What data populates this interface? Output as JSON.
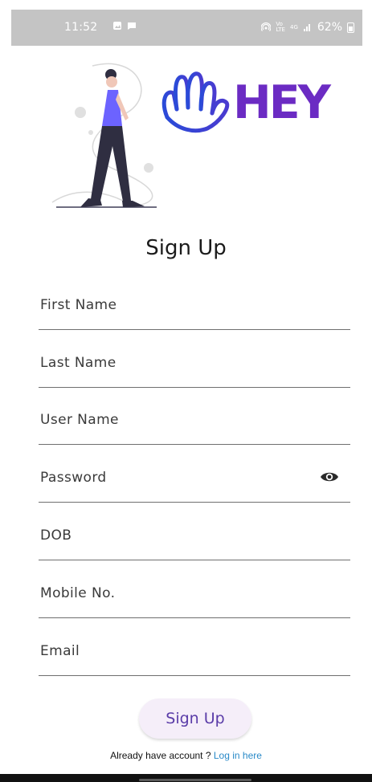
{
  "status_bar": {
    "time": "11:52",
    "battery": "62%",
    "network": "4G"
  },
  "logo": {
    "text": "HEY",
    "colors": [
      "#2a4bd8",
      "#6b2bc3"
    ],
    "icon": "wave-hand-icon"
  },
  "title": "Sign Up",
  "form": {
    "fields": [
      {
        "label": "First Name"
      },
      {
        "label": "Last Name"
      },
      {
        "label": "User Name"
      },
      {
        "label": "Password",
        "icon": "eye-icon"
      },
      {
        "label": "DOB"
      },
      {
        "label": "Mobile No."
      },
      {
        "label": "Email"
      }
    ],
    "submit_label": "Sign Up"
  },
  "login_prompt": {
    "text": "Already have account ?",
    "link_text": "Log in here"
  }
}
